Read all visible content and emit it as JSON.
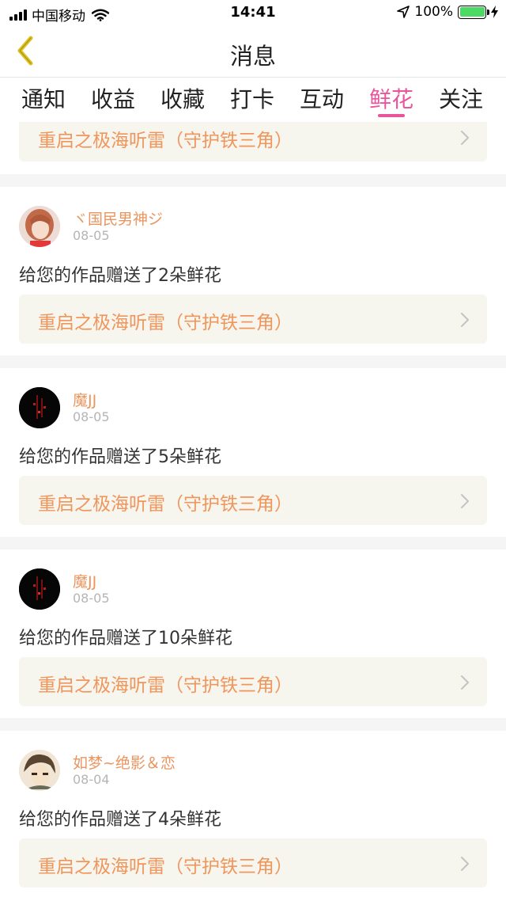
{
  "status_bar": {
    "carrier": "中国移动",
    "time": "14:41",
    "battery": "100%"
  },
  "nav": {
    "title": "消息"
  },
  "tabs": [
    {
      "label": "通知"
    },
    {
      "label": "收益"
    },
    {
      "label": "收藏"
    },
    {
      "label": "打卡"
    },
    {
      "label": "互动"
    },
    {
      "label": "鲜花",
      "active": true
    },
    {
      "label": "关注"
    }
  ],
  "partial_item": {
    "work_title": "重启之极海听雷（守护铁三角）"
  },
  "items": [
    {
      "username": "ヾ国民男神ジ",
      "date": "08-05",
      "message": "给您的作品赠送了2朵鲜花",
      "work_title": "重启之极海听雷（守护铁三角）"
    },
    {
      "username": "魔JJ",
      "date": "08-05",
      "message": "给您的作品赠送了5朵鲜花",
      "work_title": "重启之极海听雷（守护铁三角）"
    },
    {
      "username": "魔JJ",
      "date": "08-05",
      "message": "给您的作品赠送了10朵鲜花",
      "work_title": "重启之极海听雷（守护铁三角）"
    },
    {
      "username": "如梦~绝影＆恋",
      "date": "08-04",
      "message": "给您的作品赠送了4朵鲜花",
      "work_title": "重启之极海听雷（守护铁三角）"
    }
  ],
  "colors": {
    "accent": "#e9559a",
    "username": "#e9955f",
    "work_title": "#f0965c",
    "link_bg": "#f6f5ee"
  }
}
